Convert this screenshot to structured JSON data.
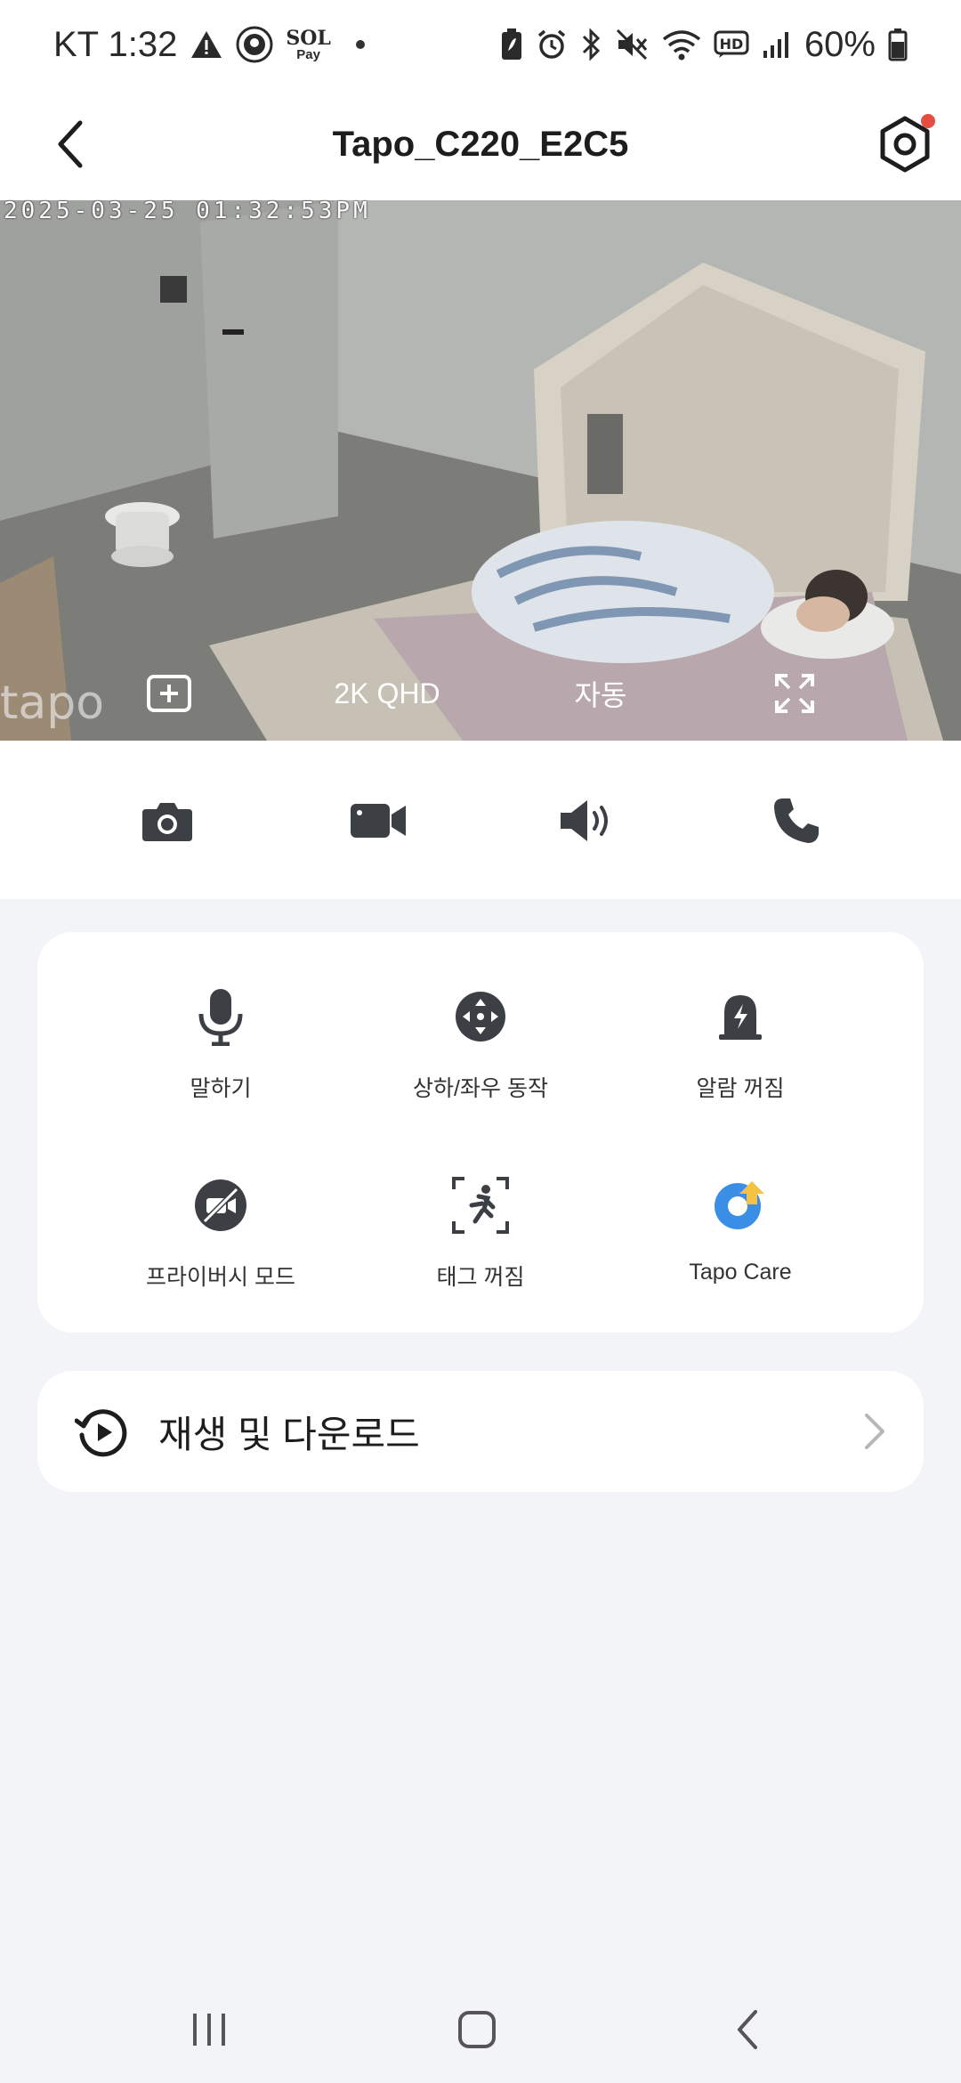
{
  "status_bar": {
    "carrier_time": "KT 1:32",
    "battery": "60%",
    "sol_top": "SOL",
    "sol_bottom": "Pay",
    "icons": [
      "warning-icon",
      "starbucks-icon",
      "sol-pay-icon",
      "notification-dot",
      "battery-saver-icon",
      "alarm-icon",
      "bluetooth-icon",
      "mute-icon",
      "wifi-icon",
      "hd-voice-icon",
      "signal-icon",
      "battery-icon"
    ]
  },
  "header": {
    "title": "Tapo_C220_E2C5",
    "back_icon": "chevron-left-icon",
    "settings_icon": "gear-icon",
    "settings_badge_color": "#e54d42"
  },
  "camera": {
    "timestamp": "2025-03-25 01:32:53PM",
    "watermark": "tapo",
    "controls": {
      "add_icon": "add-square-icon",
      "quality": "2K QHD",
      "mode": "자동",
      "fullscreen_icon": "fullscreen-icon"
    }
  },
  "quick_actions": [
    {
      "name": "snapshot",
      "icon": "camera-icon"
    },
    {
      "name": "record",
      "icon": "video-icon"
    },
    {
      "name": "speaker",
      "icon": "speaker-icon"
    },
    {
      "name": "call",
      "icon": "phone-icon"
    }
  ],
  "features": [
    {
      "label": "말하기",
      "icon": "microphone-icon"
    },
    {
      "label": "상하/좌우 동작",
      "icon": "pan-tilt-icon"
    },
    {
      "label": "알람 꺼짐",
      "icon": "alarm-bell-icon"
    },
    {
      "label": "프라이버시 모드",
      "icon": "privacy-mode-icon"
    },
    {
      "label": "태그 꺼짐",
      "icon": "motion-tag-icon"
    },
    {
      "label": "Tapo Care",
      "icon": "tapo-care-icon"
    }
  ],
  "playback": {
    "label": "재생 및 다운로드",
    "icon": "history-play-icon"
  },
  "colors": {
    "background": "#f3f4f8",
    "card": "#ffffff",
    "icon": "#3c3f44",
    "tapo_care_blue": "#3a8ee6",
    "tapo_care_yellow": "#f5c242"
  },
  "nav_bar": {
    "icons": [
      "recent-apps-icon",
      "home-icon",
      "back-icon"
    ]
  }
}
